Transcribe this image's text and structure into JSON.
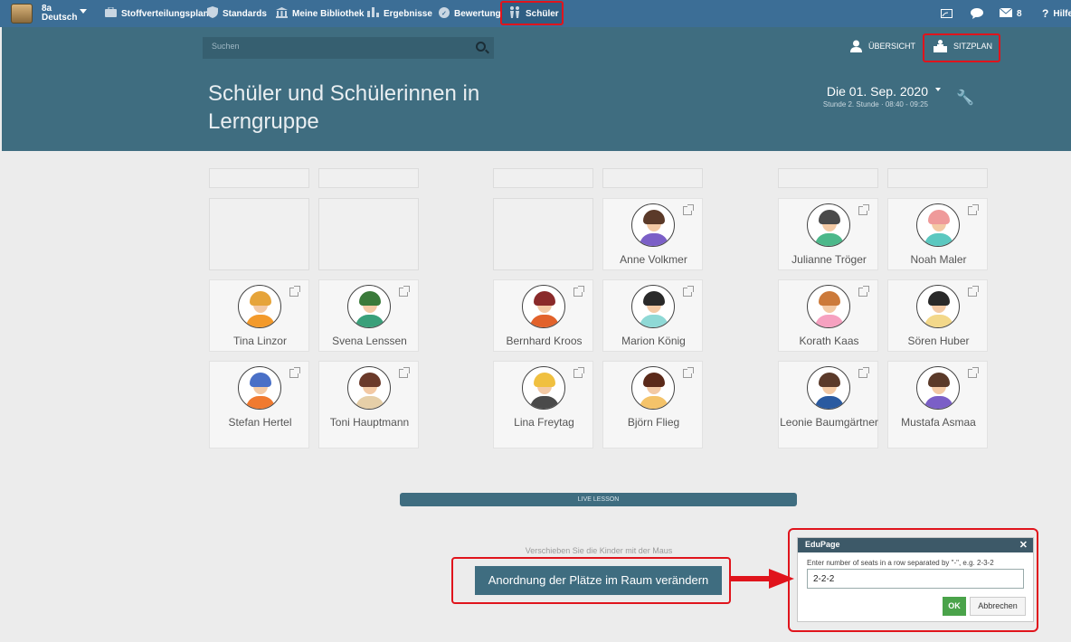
{
  "nav": {
    "class_line1": "8a",
    "class_line2": "Deutsch",
    "items": [
      {
        "label": "Stoffverteilungsplan",
        "icon": "briefcase-icon"
      },
      {
        "label": "Standards",
        "icon": "shield-icon"
      },
      {
        "label": "Meine Bibliothek",
        "icon": "library-icon"
      },
      {
        "label": "Ergebnisse",
        "icon": "bar-chart-icon"
      },
      {
        "label": "Bewertung",
        "icon": "rating-icon"
      },
      {
        "label": "Schüler",
        "icon": "students-icon"
      }
    ],
    "message_count": "8",
    "help_label": "Hilfe"
  },
  "header": {
    "search_placeholder": "Suchen",
    "overview_label": "ÜBERSICHT",
    "seating_label": "SITZPLAN",
    "title": "Schüler und Schülerinnen in Lerngruppe",
    "date": "Die 01. Sep. 2020",
    "lesson_time": "Stunde 2. Stunde · 08:40 - 09:25"
  },
  "seats": [
    "",
    "",
    "",
    "Anne Volkmer",
    "Julianne Tröger",
    "Noah Maler",
    "Tina Linzor",
    "Svena Lenssen",
    "Bernhard Kroos",
    "Marion König",
    "Korath Kaas",
    "Sören Huber",
    "Stefan Hertel",
    "Toni Hauptmann",
    "Lina Freytag",
    "Björn Flieg",
    "Leonie Baumgärtner",
    "Mustafa Asmaa"
  ],
  "live_lesson_label": "LIVE LESSON",
  "drag_hint": "Verschieben Sie die Kinder mit der Maus",
  "arrange_button": "Anordnung der Plätze im Raum verändern",
  "dialog": {
    "title": "EduPage",
    "prompt": "Enter number of seats in a row separated by \"-\", e.g. 2-3-2",
    "input_value": "2-2-2",
    "ok_label": "OK",
    "cancel_label": "Abbrechen"
  },
  "colors": {
    "nav_bg": "#3c6e96",
    "header_bg": "#3f6d80",
    "highlight_red": "#e0141c",
    "ok_green": "#4aa34a"
  }
}
